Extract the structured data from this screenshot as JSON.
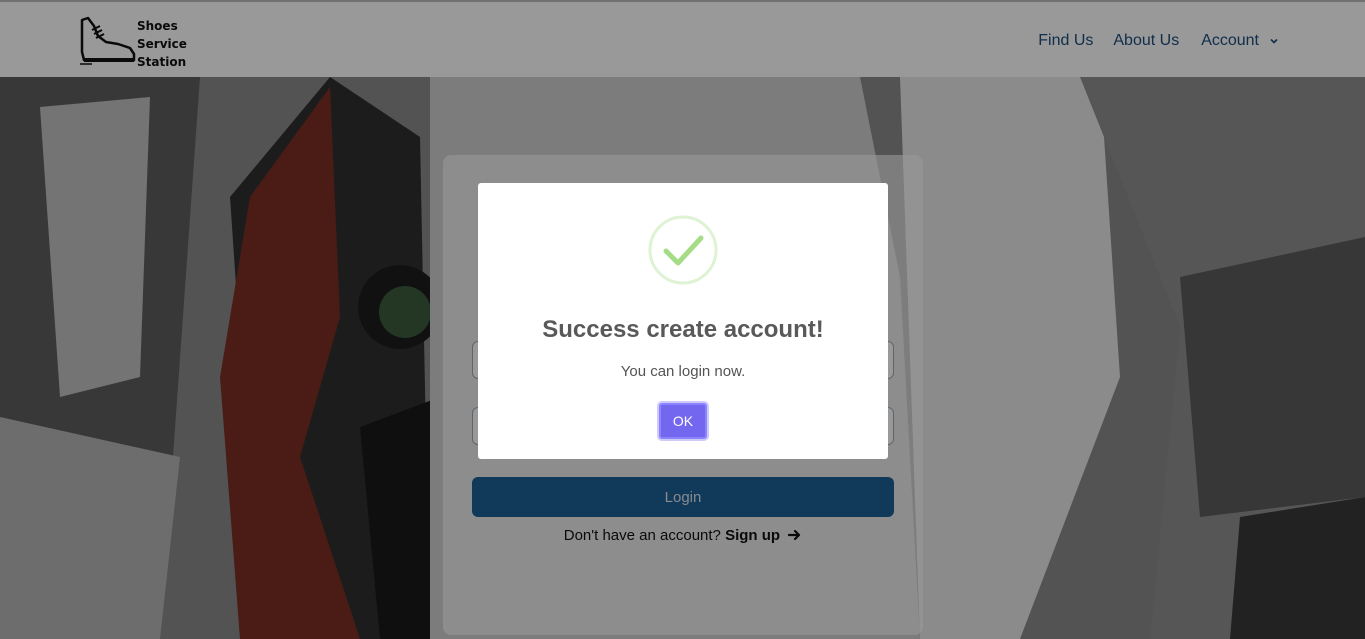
{
  "navbar": {
    "brand": {
      "line1": "Shoes",
      "line2": "Service",
      "line3": "Station"
    },
    "links": [
      {
        "label": "Find Us"
      },
      {
        "label": "About Us"
      },
      {
        "label": "Account"
      }
    ],
    "account_icon": "chevron-down-icon"
  },
  "login": {
    "button_label": "Login",
    "signup_prompt": "Don't have an account?",
    "signup_link": "Sign up",
    "signup_icon": "arrow-right-icon"
  },
  "modal": {
    "icon": "success-check-icon",
    "title": "Success create account!",
    "message": "You can login now.",
    "ok_label": "OK",
    "accent_color": "#7367f0",
    "success_color": "#a5dc86"
  }
}
